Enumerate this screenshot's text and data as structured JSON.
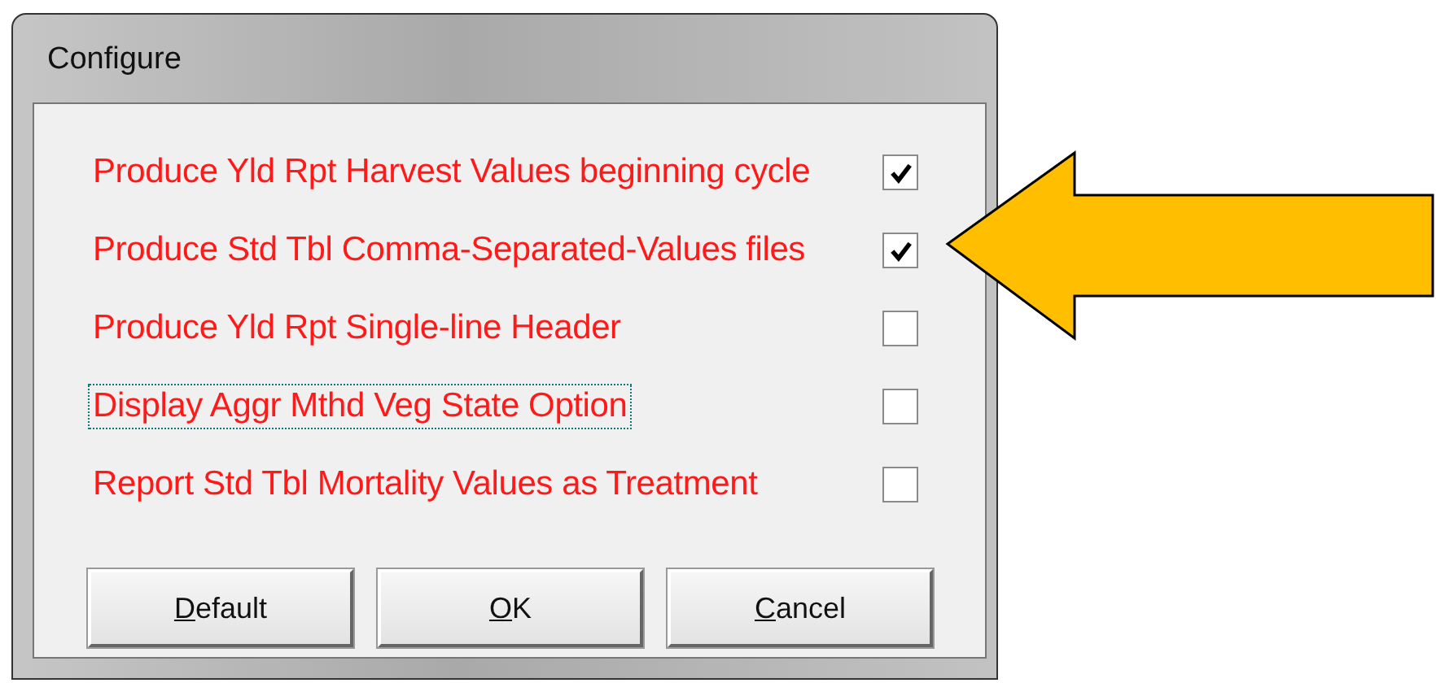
{
  "window": {
    "title": "Configure"
  },
  "options": [
    {
      "label": "Produce Yld Rpt Harvest Values beginning cycle",
      "checked": true,
      "focused": false
    },
    {
      "label": "Produce Std Tbl Comma-Separated-Values files",
      "checked": true,
      "focused": false
    },
    {
      "label": "Produce Yld Rpt Single-line Header",
      "checked": false,
      "focused": false
    },
    {
      "label": "Display Aggr Mthd Veg State Option",
      "checked": false,
      "focused": true
    },
    {
      "label": "Report Std Tbl Mortality Values as Treatment",
      "checked": false,
      "focused": false
    }
  ],
  "buttons": [
    {
      "accel": "D",
      "rest": "efault"
    },
    {
      "accel": "O",
      "rest": "K"
    },
    {
      "accel": "C",
      "rest": "ancel"
    }
  ],
  "annotation": {
    "kind": "arrow"
  }
}
